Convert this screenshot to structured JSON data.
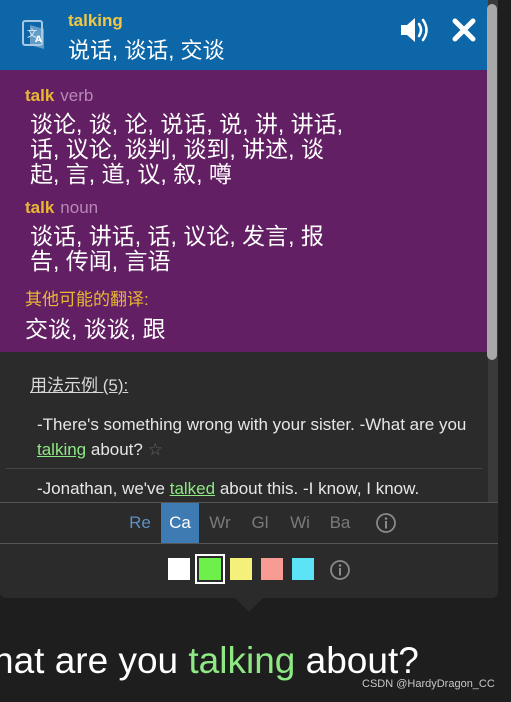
{
  "header": {
    "word": "talking",
    "main_translation": "说话, 谈话, 交谈"
  },
  "entries": [
    {
      "word": "talk",
      "pos": "verb",
      "lines": [
        "谈论, 谈, 论, 说话, 说, 讲, 讲话,",
        "话, 议论, 谈判, 谈到, 讲述, 谈",
        "起, 言, 道, 议, 叙, 噂"
      ]
    },
    {
      "word": "talk",
      "pos": "noun",
      "lines": [
        "谈话, 讲话, 话, 议论, 发言, 报",
        "告, 传闻, 言语"
      ]
    }
  ],
  "other": {
    "title": "其他可能的翻译:",
    "values": "交谈, 谈谈, 跟"
  },
  "examples": {
    "title": "用法示例 (5):",
    "items": [
      {
        "before": "-There's something wrong with your sister. -What are you ",
        "highlight": "talking",
        "after": " about?",
        "star": "☆"
      },
      {
        "before": "-Jonathan, we've ",
        "highlight": "talked",
        "after": " about this. -I know, I know.",
        "star": ""
      }
    ]
  },
  "tabs": [
    "Re",
    "Ca",
    "Wr",
    "Gl",
    "Wi",
    "Ba"
  ],
  "active_tab": "Ca",
  "highlight_colors": [
    "#ffffff",
    "#6df04a",
    "#f5f07a",
    "#f79b93",
    "#5de3f7"
  ],
  "selected_color": "#6df04a",
  "subtitle": {
    "before": "hat are you ",
    "highlight": "talking",
    "after": " about?"
  },
  "watermark": "CSDN @HardyDragon_CC"
}
